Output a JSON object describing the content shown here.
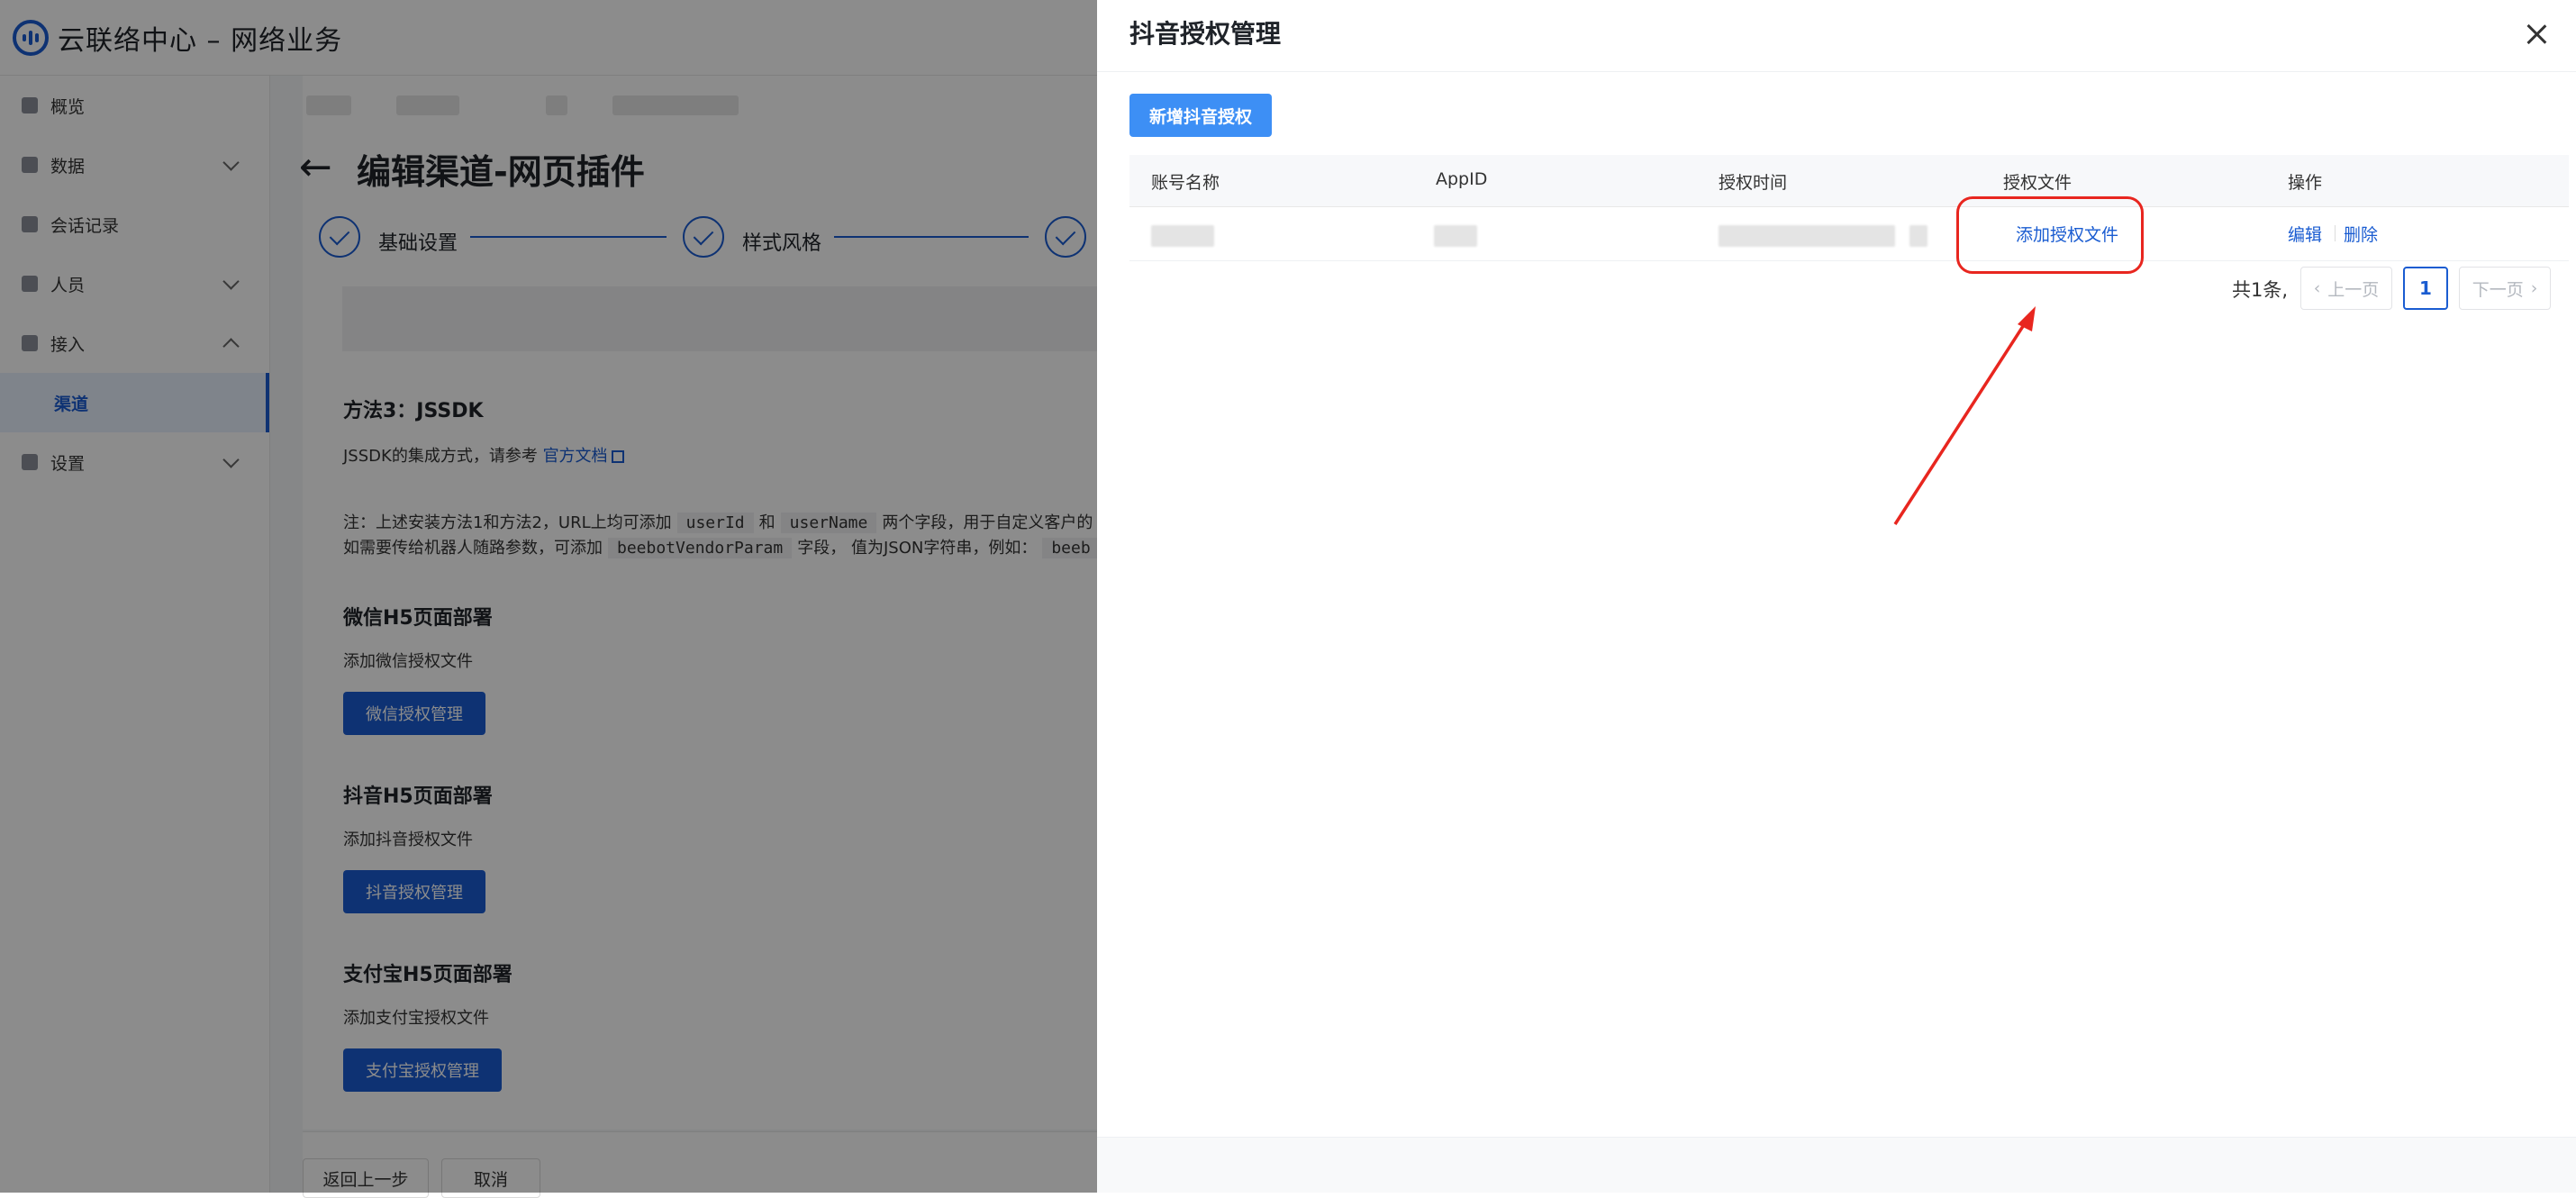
{
  "app": {
    "title": "云联络中心 – 网络业务"
  },
  "sidebar": {
    "items": [
      {
        "label": "概览"
      },
      {
        "label": "数据"
      },
      {
        "label": "会话记录"
      },
      {
        "label": "人员"
      },
      {
        "label": "接入"
      },
      {
        "label": "渠道"
      },
      {
        "label": "设置"
      }
    ]
  },
  "page": {
    "title": "编辑渠道-网页插件",
    "steps": [
      "基础设置",
      "样式风格"
    ],
    "method3_title": "方法3：JSSDK",
    "method3_desc": "JSSDK的集成方式，请参考",
    "method3_link": "官方文档",
    "note_line1_a": "注：上述安装方法1和方法2，URL上均可添加",
    "note_code_user_id": "userId",
    "note_line1_and": "和",
    "note_code_user_name": "userName",
    "note_line1_b": "两个字段，用于自定义客户的",
    "note_line2_a": "如需要传给机器人随路参数，可添加",
    "note_code_vendor": "beebotVendorParam",
    "note_line2_b": "字段，  值为JSON字符串，例如：",
    "note_code_example": "beeb",
    "wechat_title": "微信H5页面部署",
    "wechat_desc": "添加微信授权文件",
    "wechat_btn": "微信授权管理",
    "douyin_title": "抖音H5页面部署",
    "douyin_desc": "添加抖音授权文件",
    "douyin_btn": "抖音授权管理",
    "alipay_title": "支付宝H5页面部署",
    "alipay_desc": "添加支付宝授权文件",
    "alipay_btn": "支付宝授权管理",
    "back_btn": "返回上一步",
    "cancel_btn": "取消"
  },
  "drawer": {
    "title": "抖音授权管理",
    "add_button": "新增抖音授权",
    "columns": [
      "账号名称",
      "AppID",
      "授权时间",
      "授权文件",
      "操作"
    ],
    "row": {
      "auth_file_link": "添加授权文件",
      "edit": "编辑",
      "delete": "删除"
    },
    "pagination": {
      "total": "共1条,",
      "prev": "上一页",
      "current": "1",
      "next": "下一页"
    }
  },
  "colors": {
    "primary": "#1a5cd1",
    "button": "#3d8ff5",
    "annotation": "#e8261f"
  }
}
